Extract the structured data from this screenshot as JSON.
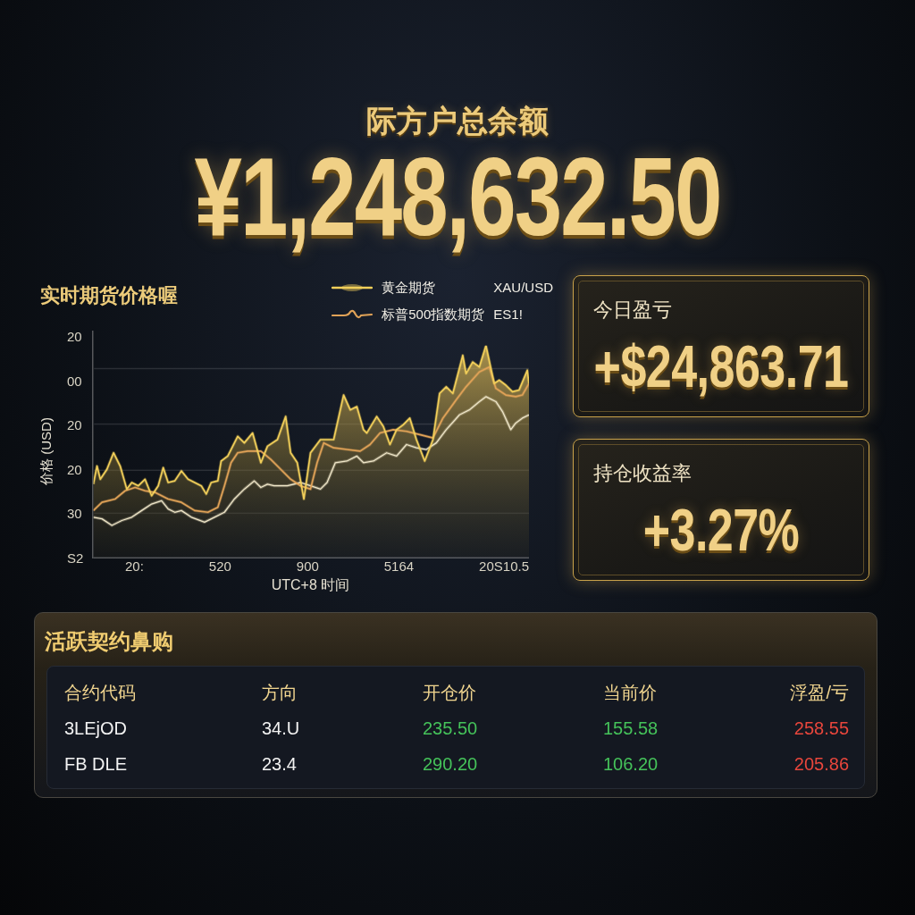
{
  "header": {
    "title": "际方户总余额",
    "balance": "¥1,248,632.50"
  },
  "chart": {
    "title": "实时期货价格喔",
    "legend": [
      {
        "kind": "line",
        "name": "黄金期货",
        "symbol": "XAU/USD",
        "color": "#f2cf5a"
      },
      {
        "kind": "wave",
        "name": "标普500指数期货",
        "symbol": "ES1!",
        "color": "#e0a257"
      }
    ],
    "y_ticks": [
      "20",
      "00",
      "20",
      "20",
      "30",
      "S2"
    ],
    "y_label": "价格 (USD)",
    "x_ticks": [
      "20:",
      "520",
      "900",
      "5164",
      "20S10.5"
    ],
    "x_label": "UTC+8 时间"
  },
  "stat_cards": [
    {
      "label": "今日盈亏",
      "value": "+$24,863.71"
    },
    {
      "label": "持仓收益率",
      "value": "+3.27%"
    }
  ],
  "positions": {
    "title": "活跃契约鼻购",
    "columns": [
      "合约代码",
      "方向",
      "开仓价",
      "当前价",
      "浮盈/亏"
    ],
    "rows": [
      {
        "cells": [
          {
            "text": "3LEjOD"
          },
          {
            "text": "34.U"
          },
          {
            "text": "235.50",
            "color": "#45c25a"
          },
          {
            "text": "155.58",
            "color": "#45c25a"
          },
          {
            "text": "258.55",
            "color": "#e8463c"
          }
        ]
      },
      {
        "cells": [
          {
            "text": "FB DLE"
          },
          {
            "text": "23.4"
          },
          {
            "text": "290.20",
            "color": "#45c25a"
          },
          {
            "text": "106.20",
            "color": "#45c25a"
          },
          {
            "text": "205.86",
            "color": "#e8463c"
          }
        ]
      }
    ]
  }
}
